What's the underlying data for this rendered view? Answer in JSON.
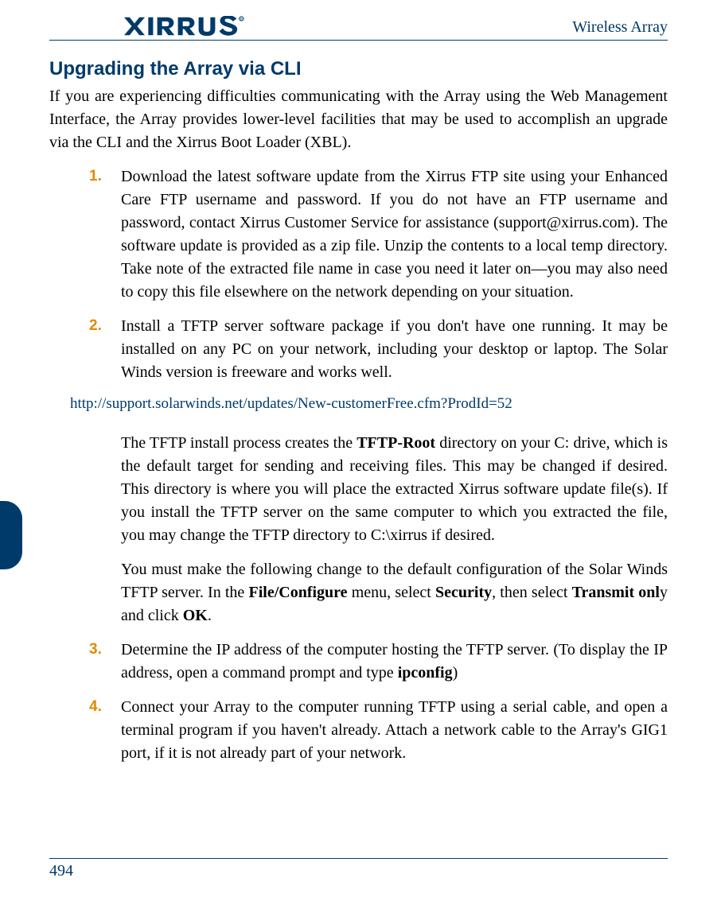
{
  "header": {
    "brand": "XIRRUS",
    "title": "Wireless Array"
  },
  "section_title": "Upgrading the Array via CLI",
  "intro": "If you are experiencing difficulties communicating with the Array using the Web Management Interface, the Array provides lower-level facilities that may be used to accomplish an upgrade via the CLI and the Xirrus Boot Loader (XBL).",
  "steps": {
    "s1_num": "1.",
    "s1": "Download the latest software update from the Xirrus FTP site using your Enhanced Care FTP username and password. If you do not have an FTP username and password, contact Xirrus Customer Service for assistance (support@xirrus.com). The software update is provided as a zip file. Unzip the contents to a local temp directory. Take note of the extracted file name in case you need it later on—you may also need to copy this file elsewhere on the network depending on your situation.",
    "s2_num": "2.",
    "s2": "Install a TFTP server software package if you don't have one running. It may be installed on any PC on your network, including your desktop or laptop. The Solar Winds version is freeware and works well.",
    "url": "http://support.solarwinds.net/updates/New-customerFree.cfm?ProdId=52",
    "s2_cont1_a": "The TFTP install process creates the ",
    "s2_cont1_bold1": "TFTP-Root",
    "s2_cont1_b": " directory on your C: drive, which is the default target for sending and receiving files. This may be changed if desired. This directory is where you will place the extracted Xirrus software update file(s). If you install the TFTP server on the same computer to which you extracted the file, you may change the TFTP directory to C:\\xirrus if desired.",
    "s2_cont2_a": "You must make the following change to the default configuration of the Solar Winds TFTP server. In the ",
    "s2_cont2_bold1": "File/Configure",
    "s2_cont2_b": " menu, select ",
    "s2_cont2_bold2": "Security",
    "s2_cont2_c": ", then select ",
    "s2_cont2_bold3": "Transmit onl",
    "s2_cont2_d": "y and click ",
    "s2_cont2_bold4": "OK",
    "s2_cont2_e": ".",
    "s3_num": "3.",
    "s3_a": "Determine the IP address of the computer hosting the TFTP server. (To display the IP address, open a command prompt and type ",
    "s3_bold1": "ipconfig",
    "s3_b": ")",
    "s4_num": "4.",
    "s4": "Connect your Array to the computer running TFTP using a serial cable, and open a terminal program if you haven't already. Attach a network cable to the Array's GIG1 port, if it is not already part of your network."
  },
  "page_number": "494"
}
